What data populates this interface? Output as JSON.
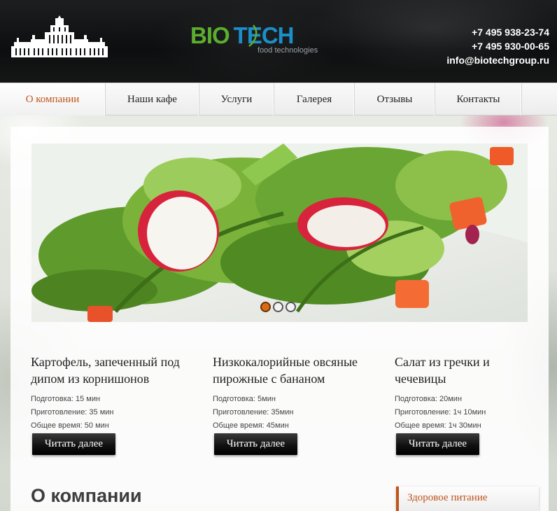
{
  "header": {
    "logo": {
      "part1": "BIO",
      "part2": "TECH",
      "subtitle": "food technologies"
    },
    "phone1": "+7 495 938-23-74",
    "phone2": "+7 495 930-00-65",
    "email": "info@biotechgroup.ru"
  },
  "nav": {
    "items": [
      {
        "label": "О компании",
        "active": true
      },
      {
        "label": "Наши кафе",
        "active": false
      },
      {
        "label": "Услуги",
        "active": false
      },
      {
        "label": "Галерея",
        "active": false
      },
      {
        "label": "Отзывы",
        "active": false
      },
      {
        "label": "Контакты",
        "active": false
      }
    ]
  },
  "slider": {
    "slide_count": 3,
    "active_index": 0
  },
  "recipes": [
    {
      "title": "Картофель, запеченный под дипом из корнишонов",
      "prep": "Подготовка: 15 мин",
      "cook": "Приготовление: 35 мин",
      "total": "Общее время: 50 мин",
      "button": "Читать далее"
    },
    {
      "title": "Низкокалорийные овсяные пирожные с бананом",
      "prep": "Подготовка: 5мин",
      "cook": "Приготовление: 35мин",
      "total": "Общее время: 45мин",
      "button": "Читать далее"
    },
    {
      "title": "Салат из гречки и чечевицы",
      "prep": "Подготовка: 20мин",
      "cook": "Приготовление: 1ч 10мин",
      "total": "Общее время: 1ч 30мин",
      "button": "Читать далее"
    }
  ],
  "about": {
    "title": "О компании"
  },
  "sidebar": {
    "box_title": "Здоровое питание"
  },
  "colors": {
    "accent": "#c0541c",
    "logo_green": "#5cae2e",
    "logo_blue": "#1b8fc9",
    "dot_active": "#d86b13"
  }
}
